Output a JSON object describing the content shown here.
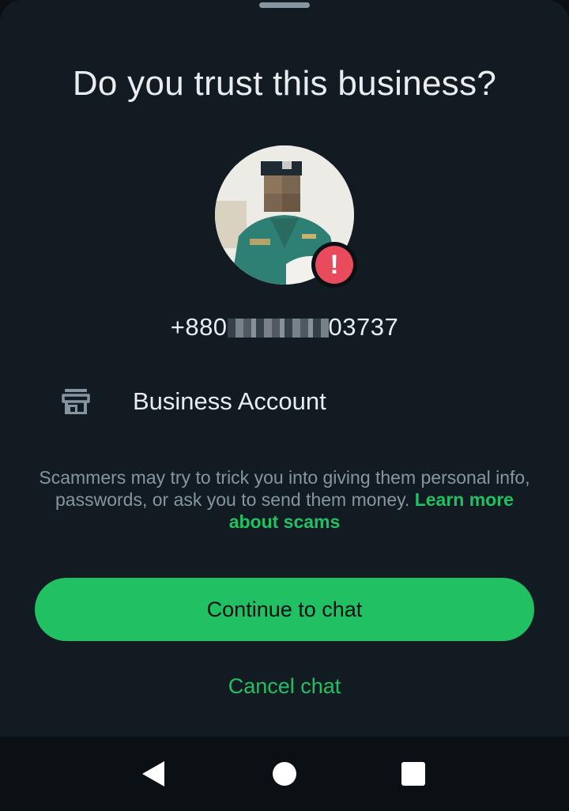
{
  "sheet": {
    "title": "Do you trust this business?",
    "phone_prefix": "+880",
    "phone_suffix": "03737",
    "business_label": "Business Account",
    "scam_text": "Scammers may try to trick you into giving them personal info, passwords, or ask you to send them money.",
    "scam_link": "Learn more about scams",
    "continue_label": "Continue to chat",
    "cancel_label": "Cancel chat",
    "warning_glyph": "!"
  },
  "icons": {
    "warning": "warning-icon",
    "store": "store-icon",
    "back": "back-icon",
    "home": "home-icon",
    "recents": "recents-icon"
  },
  "colors": {
    "background": "#121b22",
    "accent": "#21c063",
    "warning": "#ea4b5c",
    "text_primary": "#e9edef",
    "text_secondary": "#8696a0"
  }
}
